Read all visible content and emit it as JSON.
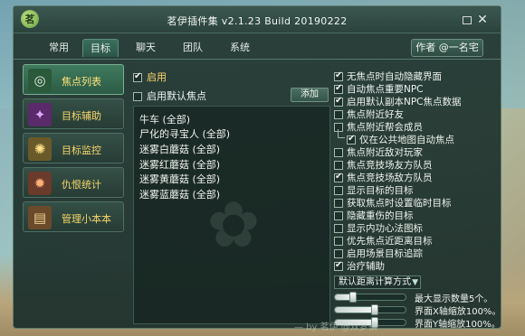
{
  "window": {
    "logo_char": "茗",
    "title": "茗伊插件集 v2.1.23 Build 20190222",
    "restore_glyph": "",
    "close_glyph": "✕"
  },
  "tabs": [
    {
      "label": "常用",
      "active": false
    },
    {
      "label": "目标",
      "active": true
    },
    {
      "label": "聊天",
      "active": false
    },
    {
      "label": "团队",
      "active": false
    },
    {
      "label": "系统",
      "active": false
    }
  ],
  "author_button": "作者 @一名宅",
  "nav": [
    {
      "label": "焦点列表",
      "icon": "bullseye-icon",
      "glyph": "◎",
      "active": true,
      "icon_bg": "#2a5a3a"
    },
    {
      "label": "目标辅助",
      "icon": "magic-icon",
      "glyph": "✦",
      "active": false,
      "icon_bg": "#5a2a6a"
    },
    {
      "label": "目标监控",
      "icon": "monitor-icon",
      "glyph": "✺",
      "active": false,
      "icon_bg": "#6a5a2a"
    },
    {
      "label": "仇恨统计",
      "icon": "hatred-icon",
      "glyph": "✹",
      "active": false,
      "icon_bg": "#6a3a2a"
    },
    {
      "label": "管理小本本",
      "icon": "book-icon",
      "glyph": "▤",
      "active": false,
      "icon_bg": "#6a4a2a"
    }
  ],
  "middle": {
    "enable_label": "启用",
    "enable_checked": true,
    "default_focus_label": "启用默认焦点",
    "default_focus_checked": false,
    "add_button": "添加",
    "list": [
      "牛车 (全部)",
      "尸化的寻宝人 (全部)",
      "迷雾白蘑菇 (全部)",
      "迷雾红蘑菇 (全部)",
      "迷雾黄蘑菇 (全部)",
      "迷雾蓝蘑菇 (全部)"
    ]
  },
  "options": [
    {
      "label": "无焦点时自动隐藏界面",
      "checked": true
    },
    {
      "label": "自动焦点重要NPC",
      "checked": true
    },
    {
      "label": "启用默认副本NPC焦点数据",
      "checked": true
    },
    {
      "label": "焦点附近好友",
      "checked": false
    },
    {
      "label": "焦点附近帮会成员",
      "checked": false
    },
    {
      "label": "仅在公共地图自动焦点",
      "checked": true,
      "indent": true
    },
    {
      "label": "焦点附近敌对玩家",
      "checked": false
    },
    {
      "label": "焦点竞技场友方队员",
      "checked": false
    },
    {
      "label": "焦点竞技场敌方队员",
      "checked": true
    },
    {
      "label": "显示目标的目标",
      "checked": false
    },
    {
      "label": "获取焦点时设置临时目标",
      "checked": false
    },
    {
      "label": "隐藏重伤的目标",
      "checked": false
    },
    {
      "label": "显示内功心法图标",
      "checked": false
    },
    {
      "label": "优先焦点近距离目标",
      "checked": false
    },
    {
      "label": "启用场景目标追踪",
      "checked": false
    },
    {
      "label": "治疗辅助",
      "checked": true
    }
  ],
  "distance_dropdown": {
    "label": "默认距离计算方式",
    "arrow": "▼"
  },
  "sliders": [
    {
      "label": "最大显示数量5个。",
      "fraction": 0.25
    },
    {
      "label": "界面X轴缩放100%。",
      "fraction": 0.55
    },
    {
      "label": "界面Y轴缩放100%。",
      "fraction": 0.55
    }
  ],
  "footer_note": "— by 茗伊 @双梦镇"
}
